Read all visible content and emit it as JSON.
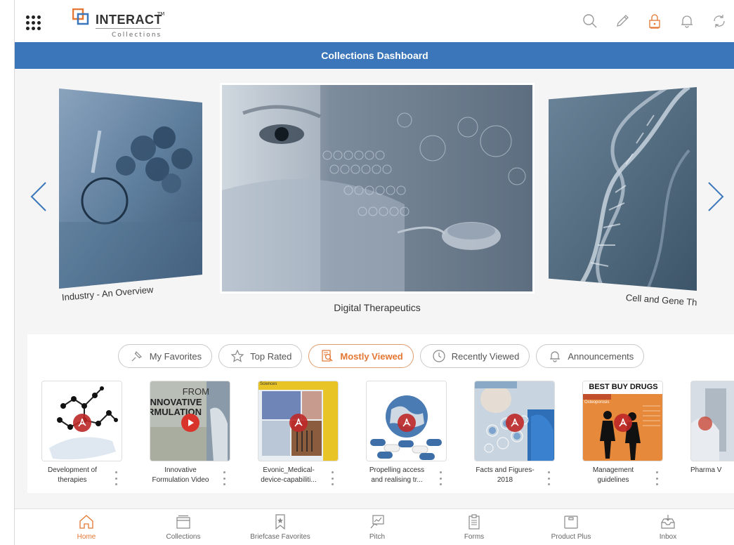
{
  "app": {
    "logo_text": "INTERACT",
    "logo_sub": "Collections",
    "logo_tm": "TM",
    "title": "Collections Dashboard"
  },
  "header_icons": [
    "search-icon",
    "pencil-icon",
    "lock-icon",
    "bell-icon",
    "sync-icon"
  ],
  "carousel": {
    "left_caption": "Industry - An Overview",
    "center_caption": "Digital Therapeutics",
    "right_caption": "Cell and Gene Th"
  },
  "tabs": [
    {
      "label": "My Favorites",
      "icon": "pin-icon",
      "active": false
    },
    {
      "label": "Top Rated",
      "icon": "star-icon",
      "active": false
    },
    {
      "label": "Mostly Viewed",
      "icon": "document-search-icon",
      "active": true
    },
    {
      "label": "Recently Viewed",
      "icon": "clock-icon",
      "active": false
    },
    {
      "label": "Announcements",
      "icon": "bell-icon",
      "active": false
    }
  ],
  "tiles": [
    {
      "line1": "Development of",
      "line2": "therapies",
      "type": "pdf"
    },
    {
      "line1": "Innovative",
      "line2": "Formulation Video",
      "type": "video",
      "thumb_text1": "FROM",
      "thumb_text2": "INNOVATIVE",
      "thumb_text3": "RMULATION"
    },
    {
      "line1": "Evonic_Medical-",
      "line2": "device-capabiliti...",
      "type": "pdf",
      "thumb_text1": "Sciences"
    },
    {
      "line1": "Propelling access",
      "line2": "and realising tr...",
      "type": "pdf"
    },
    {
      "line1": "Facts and Figures-",
      "line2": "2018",
      "type": "pdf"
    },
    {
      "line1": "Management",
      "line2": "guidelines",
      "type": "pdf",
      "thumb_text1": "BEST BUY DRUGS",
      "thumb_text2": "Osteoporosis"
    },
    {
      "line1": "Pharma V",
      "line2": "",
      "type": "pdf"
    }
  ],
  "bottom_nav": [
    {
      "label": "Home",
      "icon": "home-icon",
      "active": true
    },
    {
      "label": "Collections",
      "icon": "collections-icon",
      "active": false
    },
    {
      "label": "Briefcase Favorites",
      "icon": "bookmark-star-icon",
      "active": false
    },
    {
      "label": "Pitch",
      "icon": "pitch-icon",
      "active": false
    },
    {
      "label": "Forms",
      "icon": "clipboard-icon",
      "active": false
    },
    {
      "label": "Product Plus",
      "icon": "box-icon",
      "active": false
    },
    {
      "label": "Inbox",
      "icon": "inbox-icon",
      "active": false
    }
  ],
  "colors": {
    "title_bar": "#3a76b9",
    "accent": "#e37733",
    "arrow": "#3a76b9"
  }
}
